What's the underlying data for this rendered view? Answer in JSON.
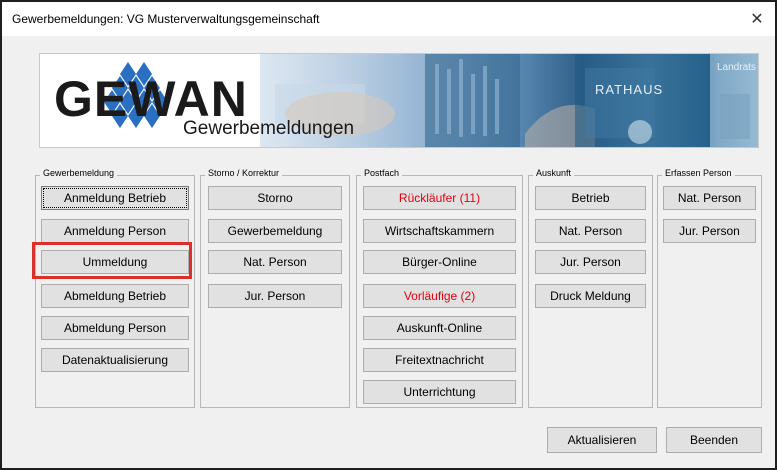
{
  "window": {
    "title": "Gewerbemeldungen: VG Musterverwaltungsgemeinschaft",
    "close_glyph": "✕"
  },
  "banner": {
    "logo": "GEWAN",
    "subtitle": "Gewerbemeldungen",
    "sign_rathaus": "RATHAUS",
    "sign_landrats": "Landrats"
  },
  "groups": {
    "gewerbemeldung": {
      "legend": "Gewerbemeldung",
      "buttons": [
        "Anmeldung Betrieb",
        "Anmeldung Person",
        "Ummeldung",
        "Abmeldung Betrieb",
        "Abmeldung Person",
        "Datenaktualisierung"
      ]
    },
    "storno": {
      "legend": "Storno / Korrektur",
      "buttons": [
        "Storno",
        "Gewerbemeldung",
        "Nat. Person",
        "Jur. Person"
      ]
    },
    "postfach": {
      "legend": "Postfach",
      "buttons": [
        "Rückläufer (11)",
        "Wirtschaftskammern",
        "Bürger-Online",
        "Vorläufige (2)",
        "Auskunft-Online",
        "Freitextnachricht",
        "Unterrichtung"
      ]
    },
    "auskunft": {
      "legend": "Auskunft",
      "buttons": [
        "Betrieb",
        "Nat. Person",
        "Jur. Person",
        "Druck Meldung"
      ]
    },
    "erfassen": {
      "legend": "Erfassen Person",
      "buttons": [
        "Nat. Person",
        "Jur. Person"
      ]
    }
  },
  "footer": {
    "refresh": "Aktualisieren",
    "exit": "Beenden"
  },
  "colors": {
    "warning_text": "#e3000f",
    "highlight_border": "#d9302b"
  }
}
